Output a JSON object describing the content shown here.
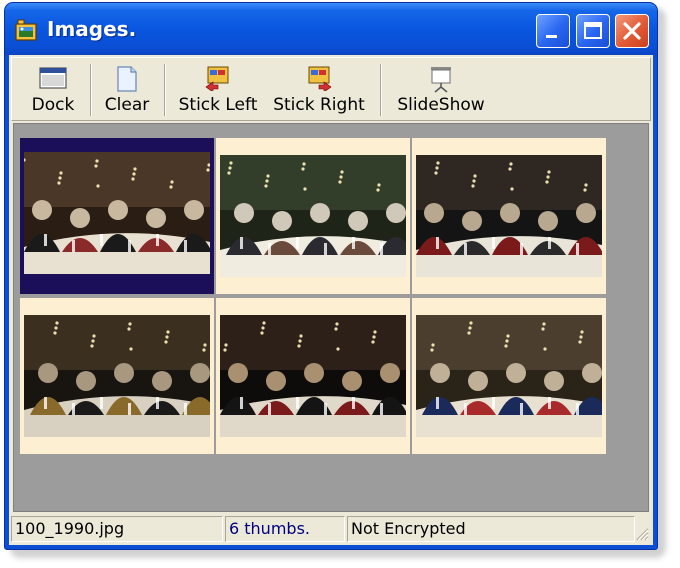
{
  "window": {
    "title": "Images.",
    "titlebar_color": "#0a4fd4",
    "controls": [
      "minimize-icon",
      "maximize-icon",
      "close-icon"
    ]
  },
  "toolbar": {
    "buttons": [
      {
        "label": "Dock",
        "icon": "dock-window-icon"
      },
      {
        "label": "Clear",
        "icon": "blank-page-icon"
      },
      {
        "label": "Stick Left",
        "icon": "stick-left-icon"
      },
      {
        "label": "Stick Right",
        "icon": "stick-right-icon"
      },
      {
        "label": "SlideShow",
        "icon": "projector-screen-icon"
      }
    ]
  },
  "thumbnails": [
    {
      "selected": true
    },
    {
      "selected": false
    },
    {
      "selected": false
    },
    {
      "selected": false
    },
    {
      "selected": false
    },
    {
      "selected": false
    }
  ],
  "status": {
    "filename": "100_1990.jpg",
    "thumb_count": "6 thumbs.",
    "encryption": "Not Encrypted",
    "thumb_count_color": "#000080"
  },
  "colors": {
    "thumbnail_background": "#fdf0d2",
    "grid_background": "#9c9c9c",
    "selection": "#1c0f5a",
    "face": "#ece9d8"
  }
}
